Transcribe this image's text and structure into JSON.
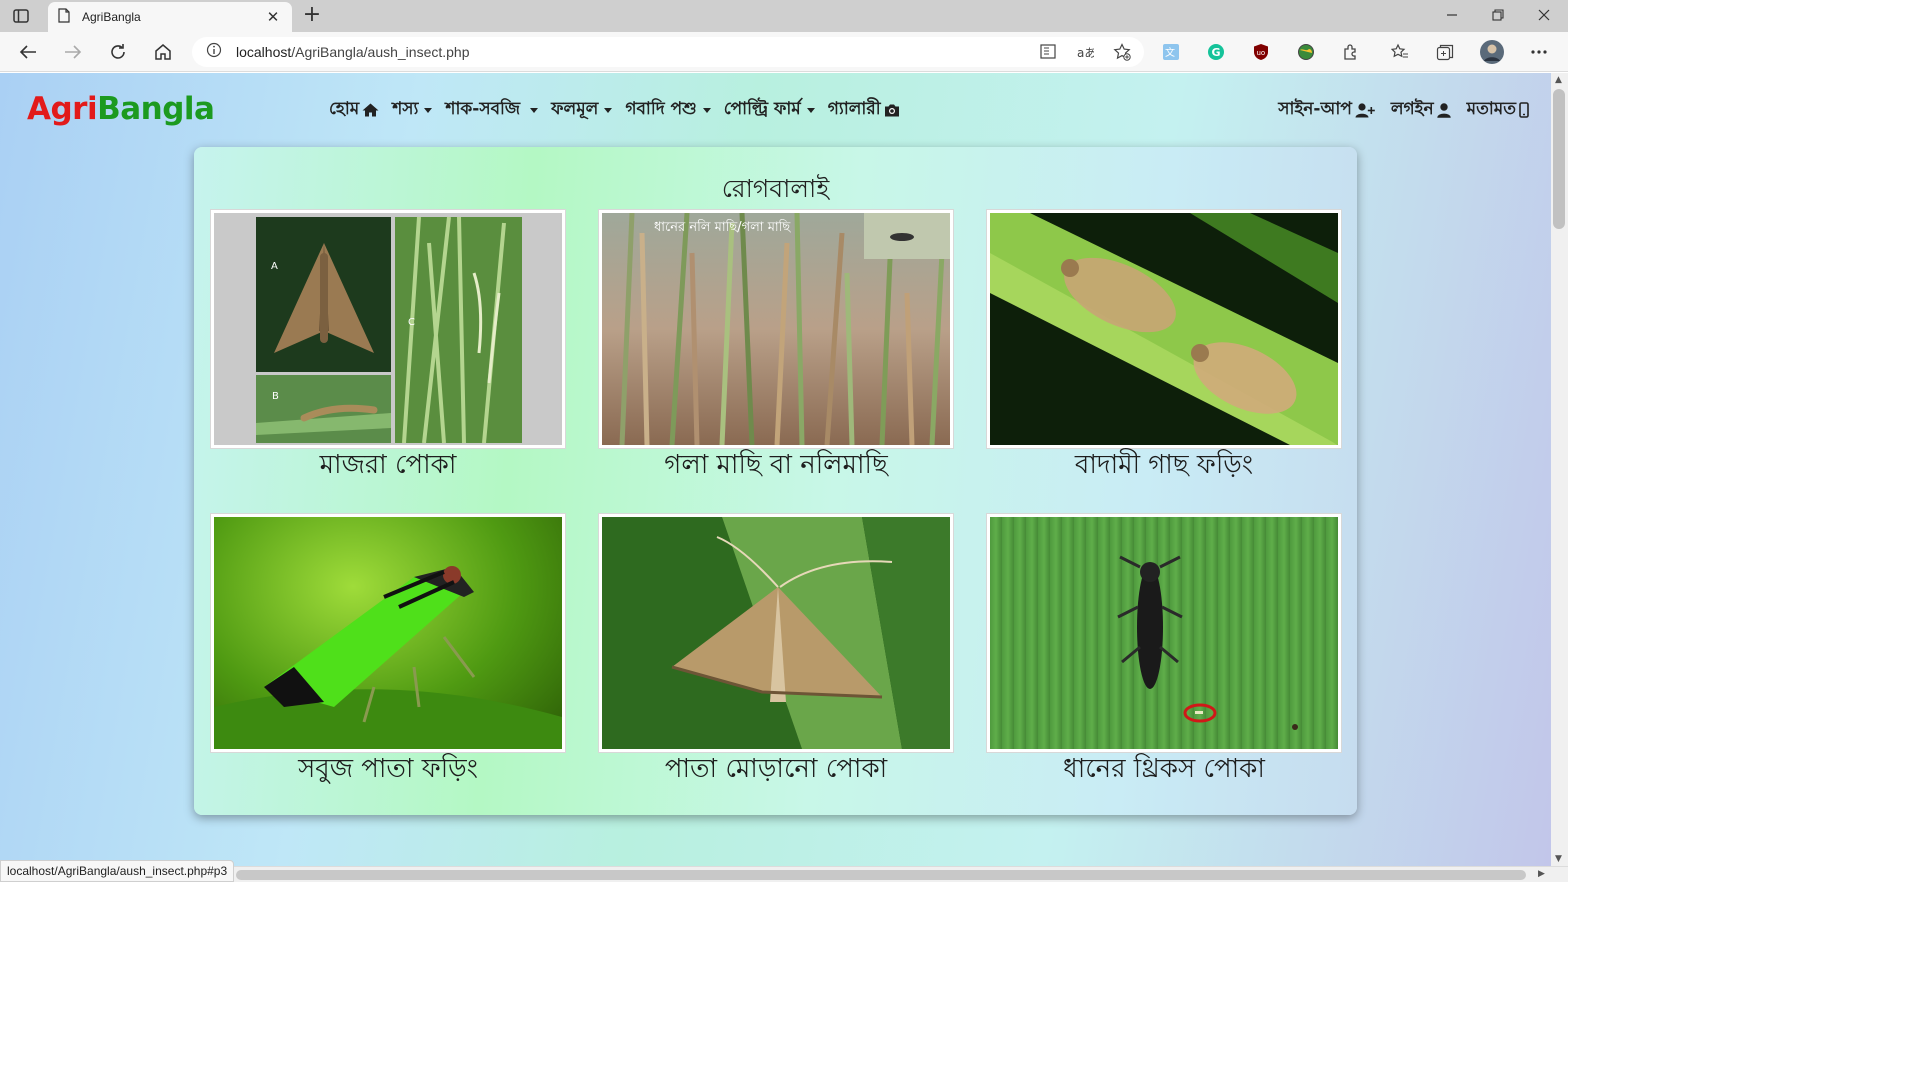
{
  "browser": {
    "tab_title": "AgriBangla",
    "tab_close": "✕",
    "new_tab": "+",
    "url_host": "localhost",
    "url_path": "/AgriBangla/aush_insect.php",
    "status_url": "localhost/AgriBangla/aush_insect.php#p3"
  },
  "site": {
    "brand_part1": "Agri",
    "brand_part2": "Bangla",
    "nav": [
      {
        "label": "হোম",
        "icon": "home-icon"
      },
      {
        "label": "শস্য",
        "icon": "caret-down-icon"
      },
      {
        "label": "শাক-সবজি",
        "icon": "caret-down-icon"
      },
      {
        "label": "ফলমূল",
        "icon": "caret-down-icon"
      },
      {
        "label": "গবাদি পশু",
        "icon": "caret-down-icon"
      },
      {
        "label": "পোল্ট্রি ফার্ম",
        "icon": "caret-down-icon"
      },
      {
        "label": "গ্যালারী",
        "icon": "camera-icon"
      }
    ],
    "nav_right": [
      {
        "label": "সাইন-আপ",
        "icon": "user-plus-icon"
      },
      {
        "label": "লগইন",
        "icon": "user-icon"
      },
      {
        "label": "মতামত",
        "icon": "mobile-icon"
      }
    ]
  },
  "panel": {
    "title": "রোগবালাই",
    "cards": [
      {
        "caption": "মাজরা পোকা"
      },
      {
        "caption": "গলা মাছি বা নলিমাছি",
        "overlay_text": "ধানের নলি মাছি/গলা মাছি"
      },
      {
        "caption": "বাদামী গাছ ফড়িং"
      },
      {
        "caption": "সবুজ পাতা ফড়িং"
      },
      {
        "caption": "পাতা মোড়ানো পোকা"
      },
      {
        "caption": "ধানের থ্রিকস পোকা"
      }
    ],
    "photo1_labels": {
      "a": "A",
      "b": "B",
      "c": "C"
    }
  }
}
